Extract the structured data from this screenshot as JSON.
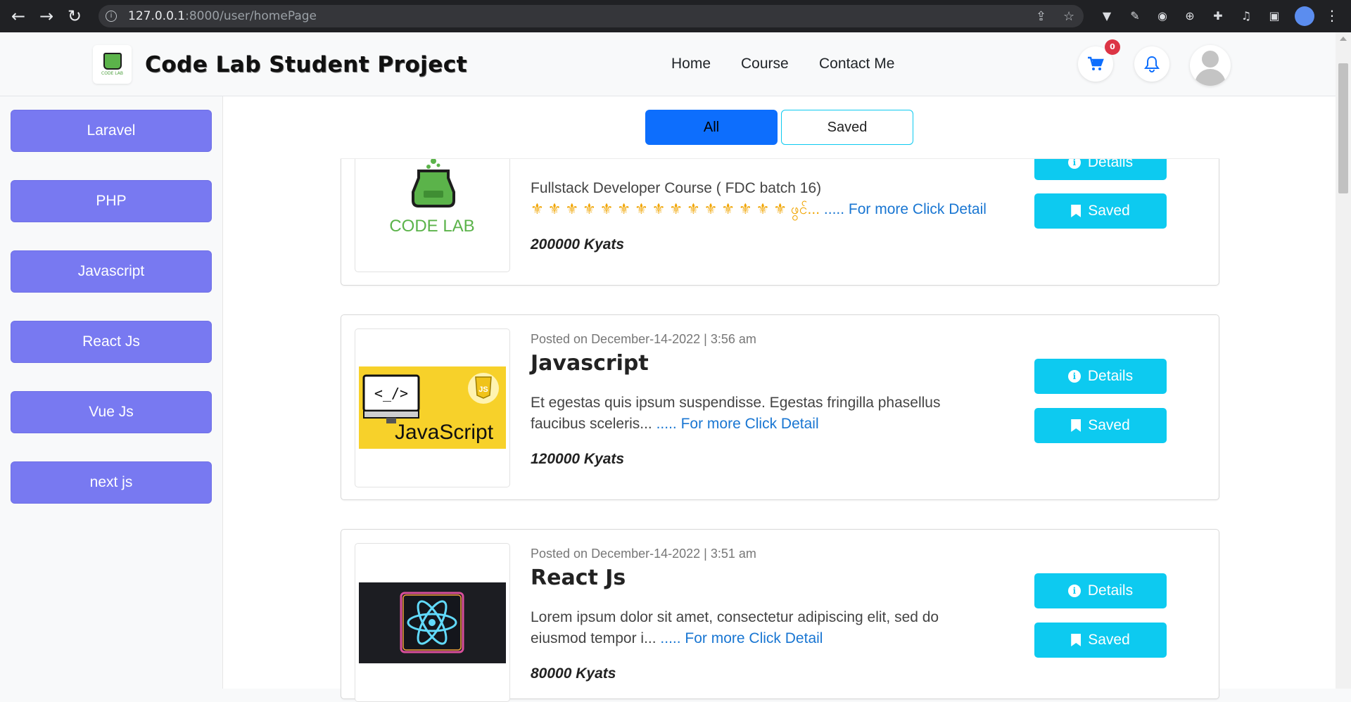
{
  "browser": {
    "url_host": "127.0.0.1",
    "url_rest": ":8000/user/homePage"
  },
  "navbar": {
    "brand": "Code Lab Student Project",
    "logo_text": "CODE LAB",
    "links": [
      "Home",
      "Course",
      "Contact Me"
    ],
    "cart_count": "0"
  },
  "sidebar": {
    "categories": [
      "Laravel",
      "PHP",
      "Javascript",
      "React Js",
      "Vue Js",
      "next js"
    ]
  },
  "tabs": {
    "all": "All",
    "saved": "Saved"
  },
  "posts": [
    {
      "posted": "",
      "title": "",
      "description": "Fullstack Developer Course ( FDC batch 16)",
      "description_line2": "⚜ ⚜ ⚜ ⚜ ⚜ ⚜ ⚜ ⚜ ⚜ ⚜ ⚜ ⚜ ⚜ ⚜ ⚜ ဖွင်...",
      "more": " ..... For more Click Detail",
      "price": "200000 Kyats",
      "thumb_label": "CODE LAB",
      "details_label": "Details",
      "saved_label": "Saved"
    },
    {
      "posted": "Posted on December-14-2022 | 3:56 am",
      "title": "Javascript",
      "description": "Et egestas quis ipsum suspendisse. Egestas fringilla phasellus faucibus sceleris...",
      "more": " ..... For more Click Detail",
      "price": "120000 Kyats",
      "thumb_label": "JavaScript",
      "details_label": "Details",
      "saved_label": "Saved"
    },
    {
      "posted": "Posted on December-14-2022 | 3:51 am",
      "title": "React Js",
      "description": "Lorem ipsum dolor sit amet, consectetur adipiscing elit, sed do eiusmod tempor i...",
      "more": " ..... For more Click Detail",
      "price": "80000 Kyats",
      "thumb_label": "",
      "details_label": "Details",
      "saved_label": "Saved"
    }
  ],
  "colors": {
    "sidebar_button": "#7879f1",
    "primary": "#0d6efd",
    "info": "#0dcaf0",
    "badge": "#dc3545"
  }
}
